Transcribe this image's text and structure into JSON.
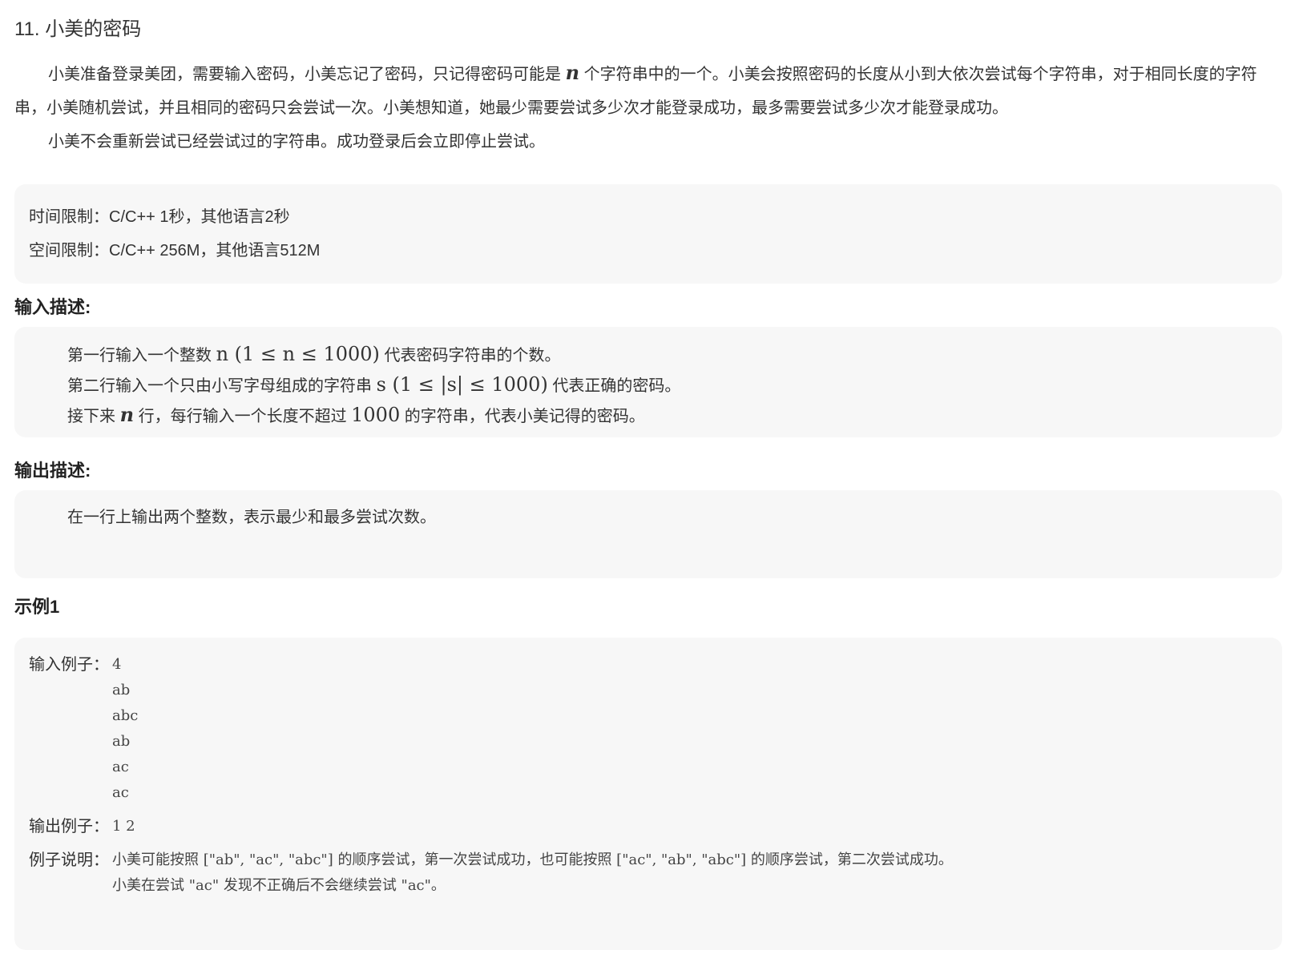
{
  "title": "11. 小美的密码",
  "description": {
    "p1_a": "小美准备登录美团，需要输入密码，小美忘记了密码，只记得密码可能是",
    "p1_var": "n",
    "p1_b": "个字符串中的一个。小美会按照密码的长度从小到大依次尝试每个字符串，对于相同长度的字符串，小美随机尝试，并且相同的密码只会尝试一次。小美想知道，她最少需要尝试多少次才能登录成功，最多需要尝试多少次才能登录成功。",
    "p2": "小美不会重新尝试已经尝试过的字符串。成功登录后会立即停止尝试。"
  },
  "limits": {
    "time": "时间限制：C/C++ 1秒，其他语言2秒",
    "space": "空间限制：C/C++ 256M，其他语言512M"
  },
  "input_section": {
    "heading": "输入描述:",
    "line1_a": "第一行输入一个整数",
    "line1_math": "n (1 ≤ n ≤ 1000)",
    "line1_b": "代表密码字符串的个数。",
    "line2_a": "第二行输入一个只由小写字母组成的字符串",
    "line2_math": "s (1 ≤ |s| ≤ 1000)",
    "line2_b": "代表正确的密码。",
    "line3_a": "接下来",
    "line3_math1": "n",
    "line3_b": "行，每行输入一个长度不超过",
    "line3_math2": "1000",
    "line3_c": "的字符串，代表小美记得的密码。"
  },
  "output_section": {
    "heading": "输出描述:",
    "line1": "在一行上输出两个整数，表示最少和最多尝试次数。"
  },
  "example": {
    "heading": "示例1",
    "input_label": "输入例子：",
    "input_lines": [
      "4",
      "ab",
      "abc",
      "ab",
      "ac",
      "ac"
    ],
    "output_label": "输出例子：",
    "output_value": "1 2",
    "explain_label": "例子说明：",
    "explain_lines": [
      "小美可能按照 [\"ab\", \"ac\", \"abc\"] 的顺序尝试，第一次尝试成功，也可能按照 [\"ac\", \"ab\", \"abc\"] 的顺序尝试，第二次尝试成功。",
      "小美在尝试 \"ac\" 发现不正确后不会继续尝试 \"ac\"。"
    ]
  }
}
